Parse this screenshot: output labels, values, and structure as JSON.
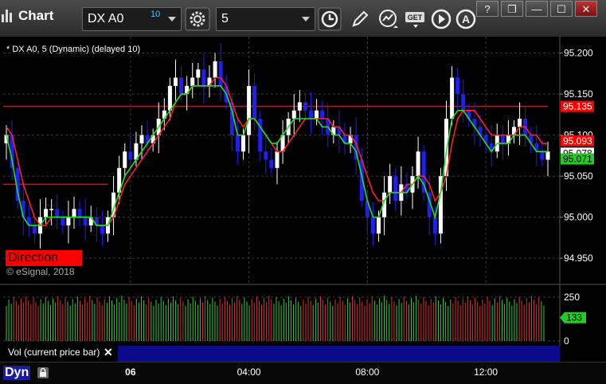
{
  "window": {
    "title": "Chart",
    "symbol": "DX A0",
    "delay_badge": "10",
    "interval": "5",
    "buttons": {
      "help": "?",
      "restore": "❐",
      "minimize": "—",
      "maximize": "☐",
      "close": "✕"
    },
    "icons": [
      "chart-bars-icon",
      "gear-icon",
      "clock-icon",
      "pencil-icon",
      "trend-icon",
      "get-icon",
      "play-icon",
      "alert-icon"
    ]
  },
  "chart_header": "* DX A0, 5 (Dynamic) (delayed 10)",
  "direction_label": "Direction",
  "copyright": "© eSignal, 2018",
  "volume_pane": {
    "label": "Vol (current price bar)",
    "close_glyph": "✕",
    "ticks": [
      "250",
      "0"
    ],
    "current_label": "133"
  },
  "footer": {
    "mode": "Dyn"
  },
  "colors": {
    "up_candle": "#ffffff",
    "down_candle": "#1f1ff0",
    "ma_fast": "#ff2020",
    "ma_slow": "#22e022",
    "vol_up": "#2ecc40",
    "vol_down": "#e03030",
    "price_marker_red": "#ff0000",
    "price_marker_green": "#22cc22"
  },
  "chart_data": {
    "type": "candlestick",
    "title": "* DX A0, 5 (Dynamic) (delayed 10)",
    "ylim": [
      94.92,
      95.22
    ],
    "y_ticks": [
      95.2,
      95.15,
      95.1,
      95.05,
      95.0,
      94.95
    ],
    "y_tick_labels": [
      "95.200",
      "95.150",
      "95.100",
      "95.050",
      "95.000",
      "94.950"
    ],
    "x_ticks": [
      {
        "bar": 22,
        "label": "06"
      },
      {
        "bar": 43,
        "label": "04:00"
      },
      {
        "bar": 64,
        "label": "08:00"
      },
      {
        "bar": 85,
        "label": "12:00"
      }
    ],
    "bar_count": 97,
    "grid": true,
    "horizontal_lines": [
      {
        "value": 95.135,
        "color": "#ff0000"
      },
      {
        "value": 95.04,
        "color": "#ff0000",
        "until_bar": 18
      }
    ],
    "price_markers": [
      {
        "value": 95.135,
        "label": "95.135",
        "bg": "#ff0000",
        "fg": "#ffffff"
      },
      {
        "value": 95.093,
        "label": "95.093",
        "bg": "#ff0000",
        "fg": "#ffffff"
      },
      {
        "value": 95.078,
        "label": "95.078",
        "bg": "#ffffff",
        "fg": "#000000"
      },
      {
        "value": 95.071,
        "label": "95.071",
        "bg": "#22cc22",
        "fg": "#000000"
      }
    ],
    "close": [
      95.1,
      95.06,
      95.02,
      95.0,
      94.99,
      94.98,
      95.0,
      95.01,
      95.01,
      95.0,
      94.99,
      95.0,
      95.01,
      95.0,
      94.99,
      95.0,
      94.99,
      94.98,
      95.0,
      95.03,
      95.06,
      95.08,
      95.07,
      95.09,
      95.1,
      95.09,
      95.1,
      95.12,
      95.13,
      95.16,
      95.17,
      95.15,
      95.16,
      95.17,
      95.18,
      95.16,
      95.17,
      95.19,
      95.16,
      95.14,
      95.1,
      95.08,
      95.1,
      95.16,
      95.12,
      95.08,
      95.07,
      95.06,
      95.08,
      95.1,
      95.12,
      95.13,
      95.14,
      95.13,
      95.12,
      95.13,
      95.12,
      95.1,
      95.11,
      95.1,
      95.09,
      95.1,
      95.07,
      95.02,
      95.0,
      94.98,
      95.0,
      95.03,
      95.05,
      95.02,
      95.04,
      95.03,
      95.05,
      95.08,
      95.03,
      95.0,
      94.98,
      95.05,
      95.12,
      95.17,
      95.15,
      95.13,
      95.12,
      95.11,
      95.1,
      95.09,
      95.08,
      95.1,
      95.09,
      95.1,
      95.11,
      95.12,
      95.1,
      95.09,
      95.08,
      95.07,
      95.08
    ],
    "series": [
      {
        "name": "fast MA",
        "values": [
          95.11,
          95.1,
          95.07,
          95.04,
          95.02,
          95.0,
          94.99,
          94.99,
          95.0,
          95.0,
          95.0,
          95.0,
          95.0,
          95.0,
          95.0,
          95.0,
          94.99,
          94.99,
          94.99,
          95.0,
          95.02,
          95.04,
          95.05,
          95.06,
          95.07,
          95.08,
          95.09,
          95.1,
          95.11,
          95.12,
          95.14,
          95.15,
          95.15,
          95.16,
          95.16,
          95.16,
          95.16,
          95.17,
          95.17,
          95.16,
          95.14,
          95.12,
          95.11,
          95.12,
          95.12,
          95.11,
          95.1,
          95.09,
          95.08,
          95.08,
          95.09,
          95.1,
          95.11,
          95.12,
          95.12,
          95.12,
          95.12,
          95.12,
          95.11,
          95.11,
          95.1,
          95.1,
          95.09,
          95.07,
          95.05,
          95.03,
          95.02,
          95.02,
          95.03,
          95.03,
          95.03,
          95.04,
          95.04,
          95.05,
          95.05,
          95.04,
          95.02,
          95.03,
          95.05,
          95.09,
          95.12,
          95.13,
          95.13,
          95.13,
          95.12,
          95.11,
          95.1,
          95.1,
          95.1,
          95.1,
          95.1,
          95.11,
          95.11,
          95.1,
          95.1,
          95.09,
          95.09
        ]
      },
      {
        "name": "slow MA",
        "values": [
          95.1,
          95.07,
          95.03,
          95.0,
          94.99,
          94.99,
          94.99,
          95.0,
          95.0,
          95.0,
          95.0,
          95.0,
          95.0,
          95.0,
          95.0,
          95.0,
          94.99,
          94.99,
          94.99,
          95.01,
          95.03,
          95.05,
          95.06,
          95.07,
          95.08,
          95.09,
          95.1,
          95.11,
          95.12,
          95.13,
          95.14,
          95.15,
          95.15,
          95.16,
          95.16,
          95.16,
          95.16,
          95.16,
          95.16,
          95.15,
          95.13,
          95.1,
          95.1,
          95.12,
          95.12,
          95.11,
          95.1,
          95.09,
          95.09,
          95.1,
          95.11,
          95.12,
          95.12,
          95.12,
          95.12,
          95.12,
          95.11,
          95.11,
          95.1,
          95.1,
          95.09,
          95.09,
          95.08,
          95.05,
          95.02,
          95.0,
          95.0,
          95.02,
          95.03,
          95.03,
          95.03,
          95.03,
          95.04,
          95.05,
          95.04,
          95.02,
          95.0,
          95.03,
          95.08,
          95.12,
          95.13,
          95.13,
          95.12,
          95.11,
          95.1,
          95.09,
          95.08,
          95.09,
          95.09,
          95.09,
          95.1,
          95.1,
          95.1,
          95.09,
          95.08,
          95.08,
          95.08
        ]
      }
    ],
    "volume": {
      "ylim": [
        0,
        300
      ],
      "ticks": [
        250,
        0
      ],
      "current": 133
    }
  }
}
